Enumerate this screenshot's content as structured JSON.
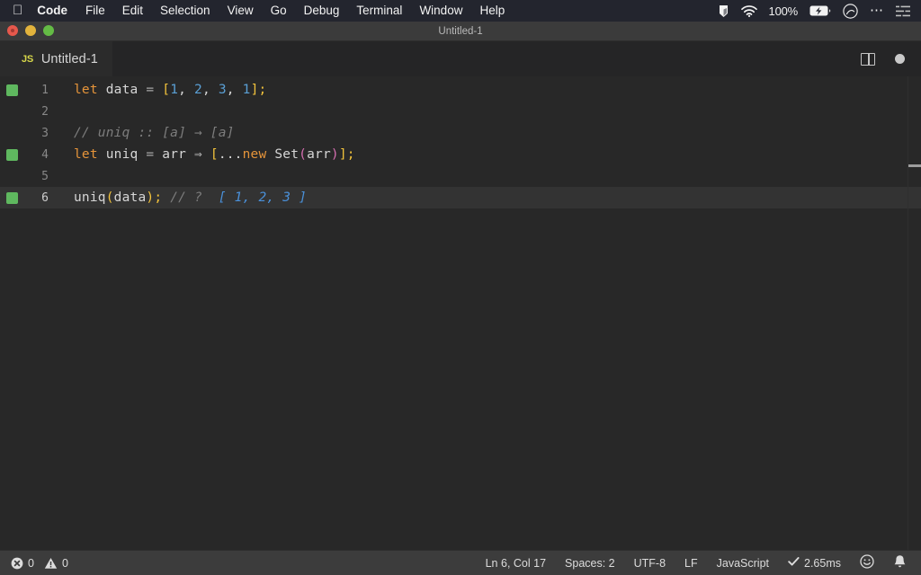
{
  "menubar": {
    "apple_icon": "apple-logo-icon",
    "items": [
      {
        "label": "Code",
        "bold": true
      },
      {
        "label": "File",
        "bold": false
      },
      {
        "label": "Edit",
        "bold": false
      },
      {
        "label": "Selection",
        "bold": false
      },
      {
        "label": "View",
        "bold": false
      },
      {
        "label": "Go",
        "bold": false
      },
      {
        "label": "Debug",
        "bold": false
      },
      {
        "label": "Terminal",
        "bold": false
      },
      {
        "label": "Window",
        "bold": false
      },
      {
        "label": "Help",
        "bold": false
      }
    ],
    "status_icons": {
      "app_icon": "dropbox-icon",
      "wifi_icon": "wifi-icon",
      "battery_percent": "100%",
      "battery_icon": "battery-charging-icon",
      "siri_icon": "siri-icon",
      "more_icon": "ellipsis-icon",
      "control_center_icon": "control-center-icon"
    }
  },
  "window": {
    "title": "Untitled-1",
    "traffic_lights": [
      "close-button",
      "minimize-button",
      "zoom-button"
    ]
  },
  "tabbar": {
    "tab": {
      "language_badge": "JS",
      "label": "Untitled-1"
    },
    "actions": {
      "split_editor_icon": "split-editor-icon",
      "unsaved_indicator": "unsaved-dot-icon"
    }
  },
  "editor": {
    "language": "JavaScript",
    "lines": [
      {
        "number": "1",
        "marker": true,
        "current": false,
        "tokens": [
          {
            "text": "let",
            "cls": "t-kw"
          },
          {
            "text": " data ",
            "cls": "t-plain"
          },
          {
            "text": "= ",
            "cls": "t-punct"
          },
          {
            "text": "[",
            "cls": "t-bracket"
          },
          {
            "text": "1",
            "cls": "t-num"
          },
          {
            "text": ", ",
            "cls": "t-plain"
          },
          {
            "text": "2",
            "cls": "t-num"
          },
          {
            "text": ", ",
            "cls": "t-plain"
          },
          {
            "text": "3",
            "cls": "t-num"
          },
          {
            "text": ", ",
            "cls": "t-plain"
          },
          {
            "text": "1",
            "cls": "t-num"
          },
          {
            "text": "];",
            "cls": "t-bracket"
          }
        ]
      },
      {
        "number": "2",
        "marker": false,
        "current": false,
        "tokens": []
      },
      {
        "number": "3",
        "marker": false,
        "current": false,
        "tokens": [
          {
            "text": "// uniq :: [a] → [a]",
            "cls": "t-comment"
          }
        ]
      },
      {
        "number": "4",
        "marker": true,
        "current": false,
        "tokens": [
          {
            "text": "let",
            "cls": "t-kw"
          },
          {
            "text": " uniq ",
            "cls": "t-plain"
          },
          {
            "text": "= ",
            "cls": "t-punct"
          },
          {
            "text": "arr ",
            "cls": "t-plain"
          },
          {
            "text": "⇒ ",
            "cls": "t-arrow"
          },
          {
            "text": "[",
            "cls": "t-bracket"
          },
          {
            "text": "...",
            "cls": "t-plain"
          },
          {
            "text": "new",
            "cls": "t-kw"
          },
          {
            "text": " Set",
            "cls": "t-plain"
          },
          {
            "text": "(",
            "cls": "t-paren"
          },
          {
            "text": "arr",
            "cls": "t-plain"
          },
          {
            "text": ")",
            "cls": "t-paren"
          },
          {
            "text": "];",
            "cls": "t-bracket"
          }
        ]
      },
      {
        "number": "5",
        "marker": false,
        "current": false,
        "tokens": []
      },
      {
        "number": "6",
        "marker": true,
        "current": true,
        "tokens": [
          {
            "text": "uniq",
            "cls": "t-plain"
          },
          {
            "text": "(",
            "cls": "t-bracket"
          },
          {
            "text": "data",
            "cls": "t-plain"
          },
          {
            "text": ");",
            "cls": "t-bracket"
          },
          {
            "text": " // ?",
            "cls": "t-comment"
          },
          {
            "text": "  [ 1, 2, 3 ]",
            "cls": "t-result"
          }
        ]
      }
    ]
  },
  "statusbar": {
    "errors_icon": "error-circle-icon",
    "errors_count": "0",
    "warnings_icon": "warning-triangle-icon",
    "warnings_count": "0",
    "cursor_position": "Ln 6, Col 17",
    "indentation": "Spaces: 2",
    "encoding": "UTF-8",
    "eol": "LF",
    "language_mode": "JavaScript",
    "run_check_icon": "check-icon",
    "run_time": "2.65ms",
    "feedback_icon": "smiley-icon",
    "notifications_icon": "bell-icon"
  },
  "colors": {
    "menubar_bg": "#23252e",
    "titlebar_bg": "#3b3b3b",
    "tabbar_bg": "#252526",
    "editor_bg": "#282828",
    "current_line_bg": "#333333",
    "statusbar_bg": "#3c3c3c",
    "keyword": "#e5943a",
    "bracket": "#f3c33c",
    "number": "#5a9fd4",
    "paren": "#d66fb1",
    "comment": "#7d7d7d",
    "result": "#4a90d9",
    "marker_green": "#5fb85f",
    "js_badge": "#d7d74a"
  }
}
